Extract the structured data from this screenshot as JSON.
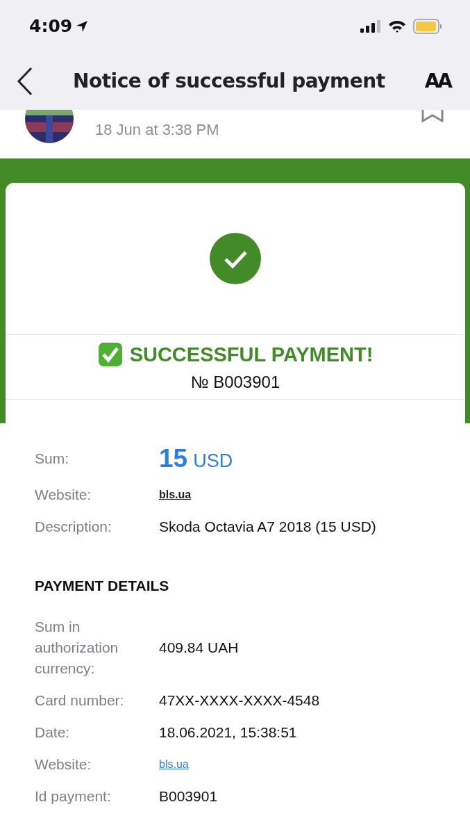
{
  "status_bar": {
    "time": "4:09"
  },
  "nav": {
    "title": "Notice of successful payment",
    "text_size_button": "AA"
  },
  "email": {
    "date": "18 Jun at 3:38 PM"
  },
  "receipt": {
    "heading": "SUCCESSFUL PAYMENT!",
    "number": "№ B003901",
    "summary": [
      {
        "kind": "amount",
        "label": "Sum:",
        "amount": "15",
        "currency": "USD"
      },
      {
        "kind": "bold-link",
        "label": "Website:",
        "value": "bls.ua"
      },
      {
        "kind": "text",
        "label": "Description:",
        "value": "Skoda Octavia A7 2018 (15 USD)"
      }
    ],
    "details_title": "PAYMENT DETAILS",
    "details": [
      {
        "kind": "text",
        "label": "Sum in authorization currency:",
        "value": "409.84 UAH"
      },
      {
        "kind": "text",
        "label": "Card number:",
        "value": "47XX-XXXX-XXXX-4548"
      },
      {
        "kind": "text",
        "label": "Date:",
        "value": "18.06.2021, 15:38:51"
      },
      {
        "kind": "link",
        "label": "Website:",
        "value": "bls.ua"
      },
      {
        "kind": "text",
        "label": "Id payment:",
        "value": "B003901"
      }
    ]
  }
}
